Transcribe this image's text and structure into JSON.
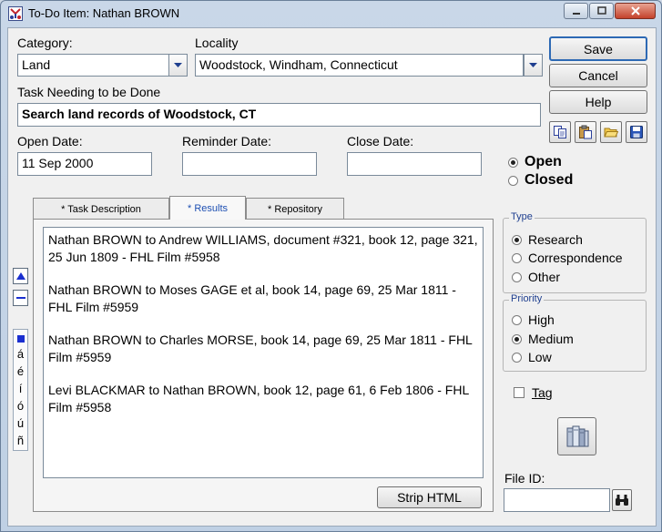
{
  "window": {
    "title": "To-Do Item: Nathan BROWN"
  },
  "labels": {
    "category": "Category:",
    "locality": "Locality",
    "task": "Task Needing to be Done",
    "open_date": "Open Date:",
    "reminder_date": "Reminder Date:",
    "close_date": "Close Date:",
    "file_id": "File ID:"
  },
  "fields": {
    "category": "Land",
    "locality": "Woodstock, Windham, Connecticut",
    "task": "Search land records of Woodstock, CT",
    "open_date": "11 Sep 2000",
    "reminder_date": "",
    "close_date": "",
    "file_id": ""
  },
  "buttons": {
    "save": "Save",
    "cancel": "Cancel",
    "help": "Help",
    "strip_html": "Strip HTML"
  },
  "status": {
    "options": [
      "Open",
      "Closed"
    ],
    "selected": "Open"
  },
  "tabs": [
    {
      "label": "* Task Description",
      "active": false
    },
    {
      "label": "* Results",
      "active": true
    },
    {
      "label": "* Repository",
      "active": false
    }
  ],
  "results": [
    "Nathan BROWN to Andrew WILLIAMS, document #321, book 12, page 321, 25 Jun 1809 - FHL Film #5958",
    "Nathan BROWN to Moses GAGE et al, book 14, page 69, 25 Mar 1811 - FHL Film #5959",
    "Nathan BROWN to Charles MORSE, book 14, page 69, 25 Mar 1811 - FHL Film #5959",
    "Levi BLACKMAR to Nathan BROWN, book 12, page 61, 6 Feb 1806 - FHL Film #5958"
  ],
  "type_group": {
    "title": "Type",
    "options": [
      "Research",
      "Correspondence",
      "Other"
    ],
    "selected": "Research"
  },
  "priority_group": {
    "title": "Priority",
    "options": [
      "High",
      "Medium",
      "Low"
    ],
    "selected": "Medium"
  },
  "tag": {
    "label": "Tag",
    "checked": false
  },
  "accents": [
    "á",
    "é",
    "í",
    "ó",
    "ú",
    "ñ"
  ],
  "icons": {
    "app": "family-tree-app-icon",
    "copy": "copy-icon",
    "paste": "paste-icon",
    "open": "folder-icon",
    "save": "disk-icon",
    "library": "books-icon",
    "find": "binoculars-icon"
  },
  "colors": {
    "active_tab": "#1d4fb2",
    "group_title": "#1f3f8f",
    "accent_square": "#1a2fd0"
  }
}
